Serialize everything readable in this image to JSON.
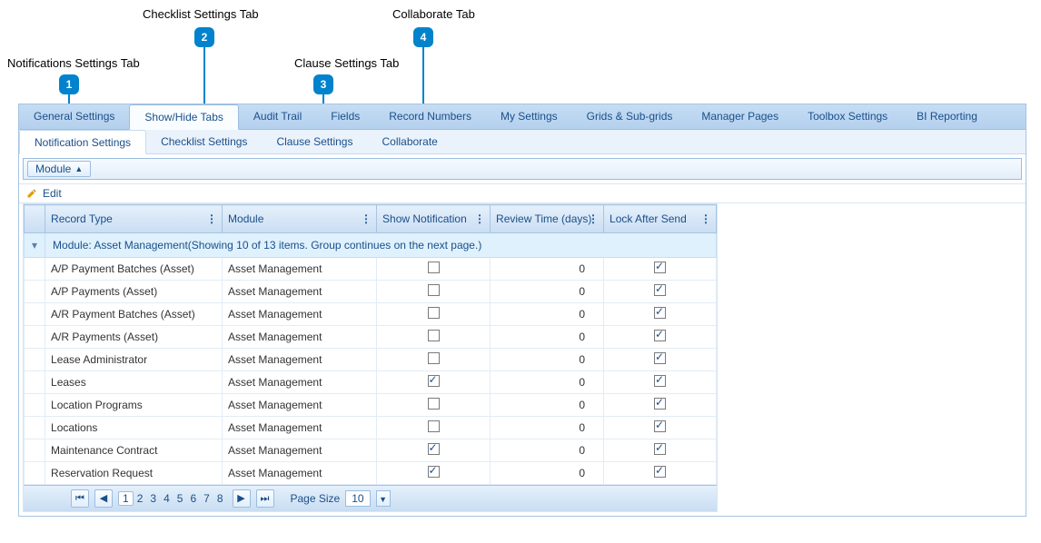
{
  "callouts": {
    "c1": {
      "label": "Notifications Settings Tab",
      "num": "1"
    },
    "c2": {
      "label": "Checklist Settings Tab",
      "num": "2"
    },
    "c3": {
      "label": "Clause Settings Tab",
      "num": "3"
    },
    "c4": {
      "label": "Collaborate Tab",
      "num": "4"
    }
  },
  "tabs1": {
    "t0": "General Settings",
    "t1": "Show/Hide Tabs",
    "t2": "Audit Trail",
    "t3": "Fields",
    "t4": "Record Numbers",
    "t5": "My Settings",
    "t6": "Grids & Sub-grids",
    "t7": "Manager Pages",
    "t8": "Toolbox Settings",
    "t9": "BI Reporting"
  },
  "tabs2": {
    "t0": "Notification Settings",
    "t1": "Checklist Settings",
    "t2": "Clause Settings",
    "t3": "Collaborate"
  },
  "group_chip": "Module",
  "edit_label": "Edit",
  "columns": {
    "c0": "Record Type",
    "c1": "Module",
    "c2": "Show Notification",
    "c3": "Review Time (days)",
    "c4": "Lock After Send"
  },
  "group_header": "Module: Asset Management(Showing 10 of 13 items. Group continues on the next page.)",
  "rows": [
    {
      "rt": "A/P Payment Batches (Asset)",
      "mod": "Asset Management",
      "show": false,
      "review": "0",
      "lock": true
    },
    {
      "rt": "A/P Payments (Asset)",
      "mod": "Asset Management",
      "show": false,
      "review": "0",
      "lock": true
    },
    {
      "rt": "A/R Payment Batches (Asset)",
      "mod": "Asset Management",
      "show": false,
      "review": "0",
      "lock": true
    },
    {
      "rt": "A/R Payments (Asset)",
      "mod": "Asset Management",
      "show": false,
      "review": "0",
      "lock": true
    },
    {
      "rt": "Lease Administrator",
      "mod": "Asset Management",
      "show": false,
      "review": "0",
      "lock": true
    },
    {
      "rt": "Leases",
      "mod": "Asset Management",
      "show": true,
      "review": "0",
      "lock": true
    },
    {
      "rt": "Location Programs",
      "mod": "Asset Management",
      "show": false,
      "review": "0",
      "lock": true
    },
    {
      "rt": "Locations",
      "mod": "Asset Management",
      "show": false,
      "review": "0",
      "lock": true
    },
    {
      "rt": "Maintenance Contract",
      "mod": "Asset Management",
      "show": true,
      "review": "0",
      "lock": true
    },
    {
      "rt": "Reservation Request",
      "mod": "Asset Management",
      "show": true,
      "review": "0",
      "lock": true
    }
  ],
  "pager": {
    "pages": [
      "1",
      "2",
      "3",
      "4",
      "5",
      "6",
      "7",
      "8"
    ],
    "current": "1",
    "size_label": "Page Size",
    "size_value": "10"
  }
}
